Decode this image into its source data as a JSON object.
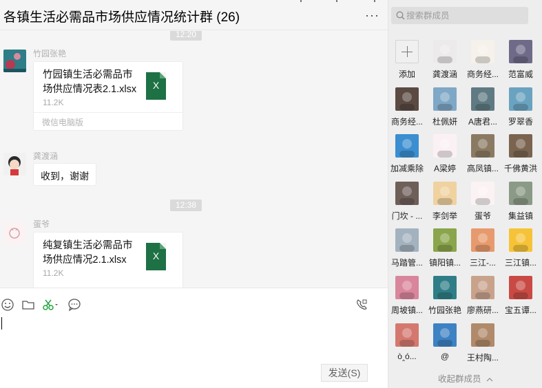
{
  "chat": {
    "title": "各镇生活必需品市场供应情况统计群 (26)",
    "more_label": "···",
    "messages": [
      {
        "type": "time",
        "text": "12:20"
      },
      {
        "type": "file",
        "sender": "竹园张艳",
        "file_name": "竹园镇生活必需品市场供应情况表2.1.xlsx",
        "file_size": "11.2K",
        "file_icon": "X",
        "source": "微信电脑版",
        "avatar_color": "#2f7d86"
      },
      {
        "type": "text",
        "sender": "龚渡涵",
        "text": "收到，谢谢",
        "avatar_color": "#eceaea"
      },
      {
        "type": "time",
        "text": "12:38"
      },
      {
        "type": "file",
        "sender": "蛋爷",
        "file_name": "纯复镇生活必需品市场供应情况2.1.xlsx",
        "file_size": "11.2K",
        "file_icon": "X",
        "avatar_color": "#fbf3f3"
      }
    ]
  },
  "toolbar": {
    "icons": [
      "emoji-icon",
      "folder-icon",
      "scissors-icon",
      "chat-bubble-icon",
      "video-call-icon"
    ]
  },
  "input": {
    "value": ""
  },
  "send_label": "发送(S)",
  "members_panel": {
    "search_placeholder": "搜索群成员",
    "collapse_label": "收起群成员",
    "add_label": "添加",
    "members": [
      {
        "name": "龚渡涵",
        "color": "#eceaea"
      },
      {
        "name": "商务经...",
        "color": "#f6f1ea"
      },
      {
        "name": "范富威",
        "color": "#6f6a88"
      },
      {
        "name": "商务经...",
        "color": "#5a4a42"
      },
      {
        "name": "杜佩妍",
        "color": "#7fa7c6"
      },
      {
        "name": "A唐君...",
        "color": "#607a83"
      },
      {
        "name": "罗翠香",
        "color": "#6aa3c0"
      },
      {
        "name": "加减乘除",
        "color": "#3b8ed0"
      },
      {
        "name": "A梁婷",
        "color": "#fbf1f5"
      },
      {
        "name": "高凤镇...",
        "color": "#8b7a63"
      },
      {
        "name": "千佛黄洪",
        "color": "#7a6450"
      },
      {
        "name": "门坎 - ...",
        "color": "#6e5f59"
      },
      {
        "name": "李剑举",
        "color": "#f0d2a0"
      },
      {
        "name": "蛋爷",
        "color": "#fbf3f3"
      },
      {
        "name": "集益镇",
        "color": "#8b9a86"
      },
      {
        "name": "马踏管...",
        "color": "#a3b2bf"
      },
      {
        "name": "镇阳镇...",
        "color": "#8aa54b"
      },
      {
        "name": "三江-...",
        "color": "#e79a6d"
      },
      {
        "name": "三江镇...",
        "color": "#f6c338"
      },
      {
        "name": "周坡镇...",
        "color": "#d9869c"
      },
      {
        "name": "竹园张艳",
        "color": "#2f7d86"
      },
      {
        "name": "廖燕研...",
        "color": "#c9a28c"
      },
      {
        "name": "宝五谭...",
        "color": "#c94a44"
      },
      {
        "name": "ò‸ó...",
        "color": "#d4786f"
      },
      {
        "name": "@",
        "color": "#3d82c2"
      },
      {
        "name": "王村陶...",
        "color": "#b08a6a"
      }
    ]
  }
}
